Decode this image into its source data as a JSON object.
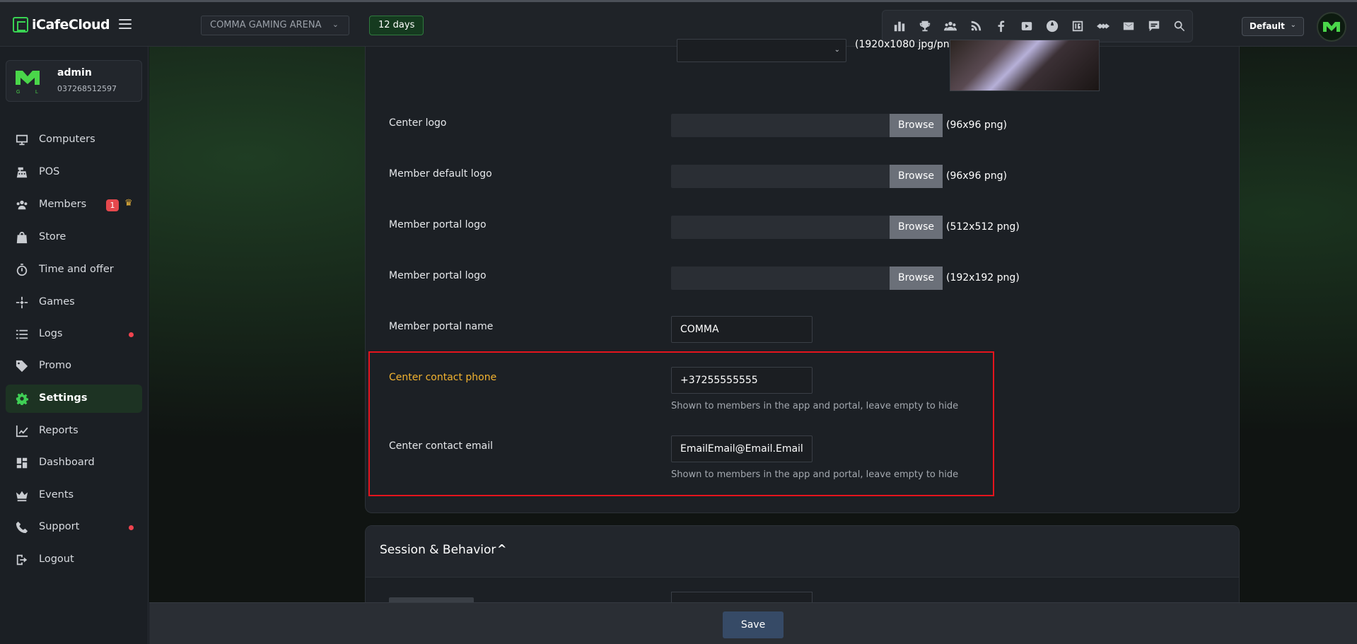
{
  "app": {
    "logo_text": "iCafeCloud",
    "accent_color": "#39d353"
  },
  "topbar": {
    "center_name": "COMMA GAMING ARENA",
    "days_left": "12 days",
    "profile_select": "Default",
    "tool_icons": [
      "stats-icon",
      "trophy-icon",
      "group-icon",
      "rss-icon",
      "facebook-icon",
      "youtube-icon",
      "globe-icon",
      "icafe-icon",
      "handshake-icon",
      "mail-icon",
      "chat-icon",
      "search-icon"
    ]
  },
  "sidebar": {
    "user": {
      "name": "admin",
      "phone": "037268512597",
      "logo_letters": "G   L"
    },
    "items": [
      {
        "label": "Computers",
        "icon": "monitor-icon"
      },
      {
        "label": "POS",
        "icon": "cash-register-icon"
      },
      {
        "label": "Members",
        "icon": "users-icon",
        "badge": "1",
        "crown": "♛"
      },
      {
        "label": "Store",
        "icon": "bag-icon"
      },
      {
        "label": "Time and offer",
        "icon": "stopwatch-icon"
      },
      {
        "label": "Games",
        "icon": "gamepad-icon"
      },
      {
        "label": "Logs",
        "icon": "list-icon",
        "dot": true
      },
      {
        "label": "Promo",
        "icon": "tag-icon"
      },
      {
        "label": "Settings",
        "icon": "gear-icon",
        "active": true
      },
      {
        "label": "Reports",
        "icon": "chart-line-icon"
      },
      {
        "label": "Dashboard",
        "icon": "dashboard-icon"
      },
      {
        "label": "Events",
        "icon": "crown-icon"
      },
      {
        "label": "Support",
        "icon": "phone-icon",
        "dot": true
      },
      {
        "label": "Logout",
        "icon": "logout-icon"
      }
    ]
  },
  "settings": {
    "top_note": "(1920x1080 jpg/png)",
    "rows": [
      {
        "label": "Center logo",
        "button": "Browse",
        "note": "(96x96 png)"
      },
      {
        "label": "Member default logo",
        "button": "Browse",
        "note": "(96x96 png)"
      },
      {
        "label": "Member portal logo",
        "button": "Browse",
        "note": "(512x512 png)"
      },
      {
        "label": "Member portal logo",
        "button": "Browse",
        "note": "(192x192 png)"
      }
    ],
    "portal_name": {
      "label": "Member portal name",
      "value": "COMMA"
    },
    "contact_phone": {
      "label": "Center contact phone",
      "value": "+37255555555",
      "help": "Shown to members in the app and portal, leave empty to hide"
    },
    "contact_email": {
      "label": "Center contact email",
      "value": "EmailEmail@Email.Email",
      "help": "Shown to members in the app and portal, leave empty to hide"
    },
    "next_section": {
      "title": "Session & Behavior",
      "chevron": "^"
    }
  },
  "footer": {
    "save_label": "Save"
  }
}
